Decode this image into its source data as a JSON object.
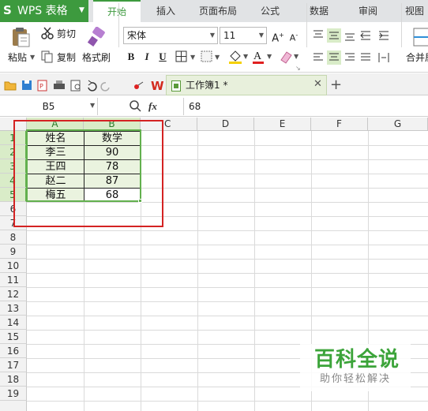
{
  "app": {
    "title": "WPS 表格",
    "logo": "S"
  },
  "tabs": [
    "开始",
    "插入",
    "页面布局",
    "公式",
    "数据",
    "审阅",
    "视图"
  ],
  "ribbon": {
    "paste": "粘贴",
    "cut": "剪切",
    "copy": "复制",
    "format_painter": "格式刷",
    "font_name": "宋体",
    "font_size": "11",
    "merge": "合并居"
  },
  "doc_tab": {
    "name": "工作簿1 *"
  },
  "formula_bar": {
    "cell_ref": "B5",
    "fx": "fx",
    "value": "68"
  },
  "columns": [
    "A",
    "B",
    "C",
    "D",
    "E",
    "F",
    "G"
  ],
  "rows": [
    "1",
    "2",
    "3",
    "4",
    "5",
    "6",
    "7",
    "8",
    "9",
    "10",
    "11",
    "12",
    "13",
    "14",
    "15",
    "16",
    "17",
    "18",
    "19"
  ],
  "table": {
    "headers": [
      "姓名",
      "数学"
    ],
    "rows": [
      [
        "李三",
        "90"
      ],
      [
        "王四",
        "78"
      ],
      [
        "赵二",
        "87"
      ],
      [
        "梅五",
        "68"
      ]
    ]
  },
  "watermark": {
    "title": "百科全说",
    "subtitle": "助你轻松解决"
  },
  "colors": {
    "accent": "#3d9a3e",
    "highlight": "#d42323",
    "selection": "#62b04e"
  }
}
